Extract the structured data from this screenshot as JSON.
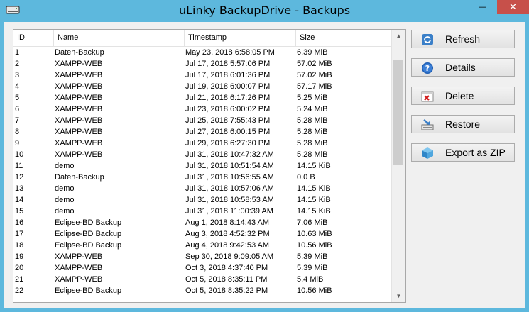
{
  "window": {
    "title": "uLinky BackupDrive - Backups",
    "minimize_glyph": "—",
    "maximize_glyph": "☐",
    "close_glyph": "✕"
  },
  "table": {
    "columns": [
      "ID",
      "Name",
      "Timestamp",
      "Size"
    ],
    "rows": [
      [
        "1",
        "Daten-Backup",
        "May 23, 2018 6:58:05 PM",
        "6.39 MiB"
      ],
      [
        "2",
        "XAMPP-WEB",
        "Jul 17, 2018 5:57:06 PM",
        "57.02 MiB"
      ],
      [
        "3",
        "XAMPP-WEB",
        "Jul 17, 2018 6:01:36 PM",
        "57.02 MiB"
      ],
      [
        "4",
        "XAMPP-WEB",
        "Jul 19, 2018 6:00:07 PM",
        "57.17 MiB"
      ],
      [
        "5",
        "XAMPP-WEB",
        "Jul 21, 2018 6:17:26 PM",
        "5.25 MiB"
      ],
      [
        "6",
        "XAMPP-WEB",
        "Jul 23, 2018 6:00:02 PM",
        "5.24 MiB"
      ],
      [
        "7",
        "XAMPP-WEB",
        "Jul 25, 2018 7:55:43 PM",
        "5.28 MiB"
      ],
      [
        "8",
        "XAMPP-WEB",
        "Jul 27, 2018 6:00:15 PM",
        "5.28 MiB"
      ],
      [
        "9",
        "XAMPP-WEB",
        "Jul 29, 2018 6:27:30 PM",
        "5.28 MiB"
      ],
      [
        "10",
        "XAMPP-WEB",
        "Jul 31, 2018 10:47:32 AM",
        "5.28 MiB"
      ],
      [
        "11",
        "demo",
        "Jul 31, 2018 10:51:54 AM",
        "14.15 KiB"
      ],
      [
        "12",
        "Daten-Backup",
        "Jul 31, 2018 10:56:55 AM",
        "0.0 B"
      ],
      [
        "13",
        "demo",
        "Jul 31, 2018 10:57:06 AM",
        "14.15 KiB"
      ],
      [
        "14",
        "demo",
        "Jul 31, 2018 10:58:53 AM",
        "14.15 KiB"
      ],
      [
        "15",
        "demo",
        "Jul 31, 2018 11:00:39 AM",
        "14.15 KiB"
      ],
      [
        "16",
        "Eclipse-BD Backup",
        "Aug 1, 2018 8:14:43 AM",
        "7.06 MiB"
      ],
      [
        "17",
        "Eclipse-BD Backup",
        "Aug 3, 2018 4:52:32 PM",
        "10.63 MiB"
      ],
      [
        "18",
        "Eclipse-BD Backup",
        "Aug 4, 2018 9:42:53 AM",
        "10.56 MiB"
      ],
      [
        "19",
        "XAMPP-WEB",
        "Sep 30, 2018 9:09:05 AM",
        "5.39 MiB"
      ],
      [
        "20",
        "XAMPP-WEB",
        "Oct 3, 2018 4:37:40 PM",
        "5.39 MiB"
      ],
      [
        "21",
        "XAMPP-WEB",
        "Oct 5, 2018 8:35:11 PM",
        "5.4 MiB"
      ],
      [
        "22",
        "Eclipse-BD Backup",
        "Oct 5, 2018 8:35:22 PM",
        "10.56 MiB"
      ]
    ]
  },
  "actions": {
    "refresh": "Refresh",
    "details": "Details",
    "delete": "Delete",
    "restore": "Restore",
    "export_zip": "Export as ZIP"
  },
  "scrollbar": {
    "up_glyph": "▲",
    "down_glyph": "▼"
  }
}
